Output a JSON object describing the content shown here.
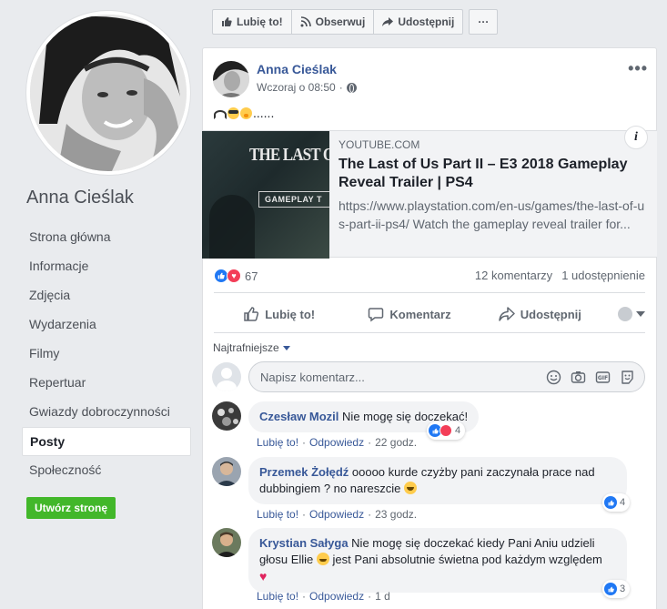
{
  "page": {
    "name": "Anna Cieślak",
    "nav": [
      {
        "label": "Strona główna"
      },
      {
        "label": "Informacje"
      },
      {
        "label": "Zdjęcia"
      },
      {
        "label": "Wydarzenia"
      },
      {
        "label": "Filmy"
      },
      {
        "label": "Repertuar"
      },
      {
        "label": "Gwiazdy dobroczynności"
      },
      {
        "label": "Posty",
        "active": true
      },
      {
        "label": "Społeczność"
      }
    ],
    "create_page_button": "Utwórz stronę"
  },
  "topbar": {
    "like": "Lubię to!",
    "follow": "Obserwuj",
    "share": "Udostępnij",
    "more": "···"
  },
  "post": {
    "author": "Anna Cieślak",
    "timestamp": "Wczoraj o 08:50",
    "privacy_icon": "globe-icon",
    "text_suffix": "......",
    "emojis": [
      "headphones",
      "sunglasses-face",
      "hushed-face"
    ],
    "link": {
      "domain": "YOUTUBE.COM",
      "title": "The Last of Us Part II – E3 2018 Gameplay Reveal Trailer | PS4",
      "description": "https://www.playstation.com/en-us/games/the-last-of-us-part-ii-ps4/ Watch the gameplay reveal trailer for...",
      "thumb_title": "THE LAST OF",
      "thumb_badge": "GAMEPLAY T"
    },
    "reactions_count": "67",
    "comments_count": "12 komentarzy",
    "shares_count": "1 udostępnienie",
    "actions": {
      "like": "Lubię to!",
      "comment": "Komentarz",
      "share": "Udostępnij"
    },
    "sort_label": "Najtrafniejsze",
    "comment_placeholder": "Napisz komentarz..."
  },
  "comments": [
    {
      "author": "Czesław Mozil",
      "text": "Nie mogę się doczekać!",
      "like": "Lubię to!",
      "reply": "Odpowiedz",
      "time": "22 godz.",
      "reactions": "4"
    },
    {
      "author": "Przemek Żołędź",
      "text": "ooooo kurde czyżby pani zaczynała prace nad dubbingiem ? no nareszcie",
      "like": "Lubię to!",
      "reply": "Odpowiedz",
      "time": "23 godz.",
      "reactions": "4"
    },
    {
      "author": "Krystian Sałyga",
      "text": "Nie mogę się doczekać kiedy Pani Aniu udzieli głosu Ellie",
      "text_2": "jest Pani absolutnie świetna pod każdym względem",
      "like": "Lubię to!",
      "reply": "Odpowiedz",
      "time": "1 d",
      "reactions": "3"
    }
  ],
  "colors": {
    "brand_blue": "#385898",
    "like_blue": "#2078f4",
    "love_red": "#f33e58",
    "create_green": "#42b72a",
    "background": "#e9ebee"
  }
}
